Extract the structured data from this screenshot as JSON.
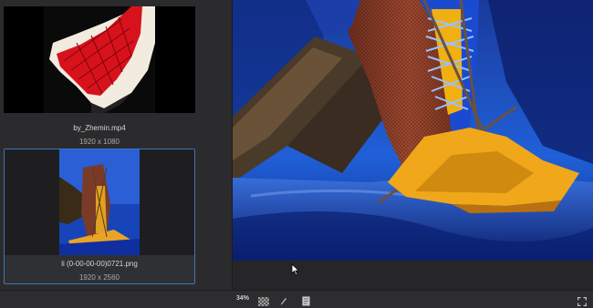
{
  "media": [
    {
      "filename": "by_Zhemin.mp4",
      "dimensions": "1920 x 1080",
      "selected": false
    },
    {
      "filename": "li (0-00-00-00)0721.png",
      "dimensions": "1920 x 2560",
      "selected": true
    }
  ],
  "statusbar": {
    "zoom": "34%",
    "icons": [
      "checkerboard-icon",
      "pencil-icon",
      "notes-icon",
      "fullscreen-icon"
    ]
  },
  "colors": {
    "selection_border": "#3f76b8",
    "panel_bg": "#2b2b2d"
  }
}
